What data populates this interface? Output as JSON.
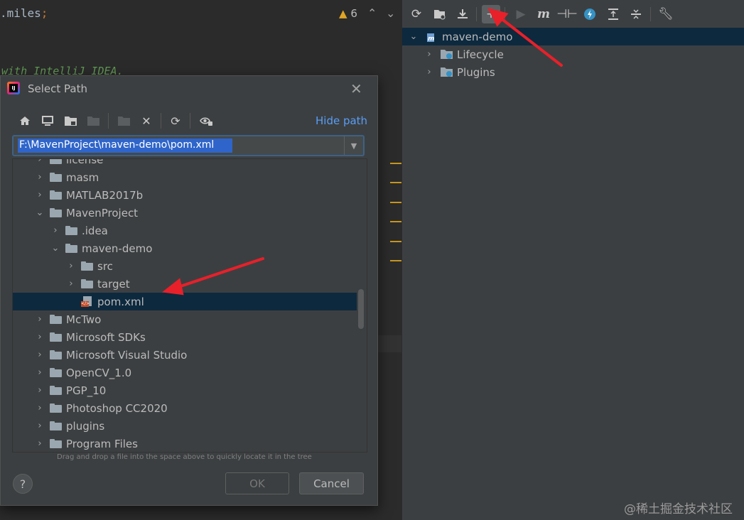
{
  "editor": {
    "code_line1": ".miles",
    "code_line1_semicolon": ";",
    "code_line2": "with IntelliJ IDEA.",
    "warning_count": "6"
  },
  "maven_panel": {
    "toolbar": [
      "reload-icon",
      "add-project-icon",
      "download-icon",
      "toggle-offline-icon",
      "run-icon",
      "execute-goal-icon",
      "skip-tests-icon",
      "lightning-icon",
      "collapse-icon",
      "expand-icon",
      "settings-wrench-icon"
    ],
    "project": "maven-demo",
    "items": [
      {
        "label": "Lifecycle"
      },
      {
        "label": "Plugins"
      }
    ]
  },
  "dialog": {
    "title": "Select Path",
    "hide_path": "Hide path",
    "path_value": "F:\\MavenProject\\maven-demo\\pom.xml",
    "tree": [
      {
        "label": "license",
        "depth": 0,
        "expanded": false,
        "type": "folder"
      },
      {
        "label": "masm",
        "depth": 0,
        "expanded": false,
        "type": "folder"
      },
      {
        "label": "MATLAB2017b",
        "depth": 0,
        "expanded": false,
        "type": "folder"
      },
      {
        "label": "MavenProject",
        "depth": 0,
        "expanded": true,
        "type": "folder"
      },
      {
        "label": ".idea",
        "depth": 1,
        "expanded": false,
        "type": "folder"
      },
      {
        "label": "maven-demo",
        "depth": 1,
        "expanded": true,
        "type": "folder"
      },
      {
        "label": "src",
        "depth": 2,
        "expanded": false,
        "type": "folder"
      },
      {
        "label": "target",
        "depth": 2,
        "expanded": false,
        "type": "folder"
      },
      {
        "label": "pom.xml",
        "depth": 2,
        "expanded": null,
        "type": "xml",
        "selected": true
      },
      {
        "label": "McTwo",
        "depth": 0,
        "expanded": false,
        "type": "folder"
      },
      {
        "label": "Microsoft SDKs",
        "depth": 0,
        "expanded": false,
        "type": "folder"
      },
      {
        "label": "Microsoft Visual Studio",
        "depth": 0,
        "expanded": false,
        "type": "folder"
      },
      {
        "label": "OpenCV_1.0",
        "depth": 0,
        "expanded": false,
        "type": "folder"
      },
      {
        "label": "PGP_10",
        "depth": 0,
        "expanded": false,
        "type": "folder"
      },
      {
        "label": "Photoshop CC2020",
        "depth": 0,
        "expanded": false,
        "type": "folder"
      },
      {
        "label": "plugins",
        "depth": 0,
        "expanded": false,
        "type": "folder"
      },
      {
        "label": "Program Files",
        "depth": 0,
        "expanded": false,
        "type": "folder"
      }
    ],
    "hint": "Drag and drop a file into the space above to quickly locate it in the tree",
    "help_label": "?",
    "ok_label": "OK",
    "cancel_label": "Cancel"
  },
  "watermark": "@稀土掘金技术社区",
  "colors": {
    "selection": "#0d293e",
    "link": "#589df6",
    "annotation_arrow": "#e8202a"
  }
}
